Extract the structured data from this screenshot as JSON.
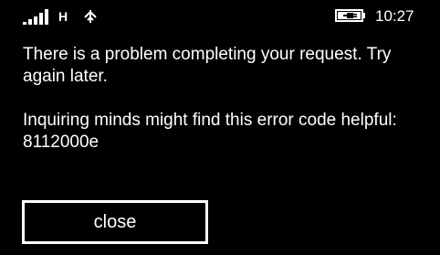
{
  "status_bar": {
    "network": "H",
    "time": "10:27",
    "icons": [
      "signal-strength-icon",
      "wifi-icon",
      "battery-charging-icon"
    ]
  },
  "dialog": {
    "message_line1": "There is a problem completing your request. Try again later.",
    "message_line2": "Inquiring minds might find this error code helpful: 8112000e",
    "close_label": "close"
  },
  "colors": {
    "background": "#000000",
    "foreground": "#ffffff"
  }
}
